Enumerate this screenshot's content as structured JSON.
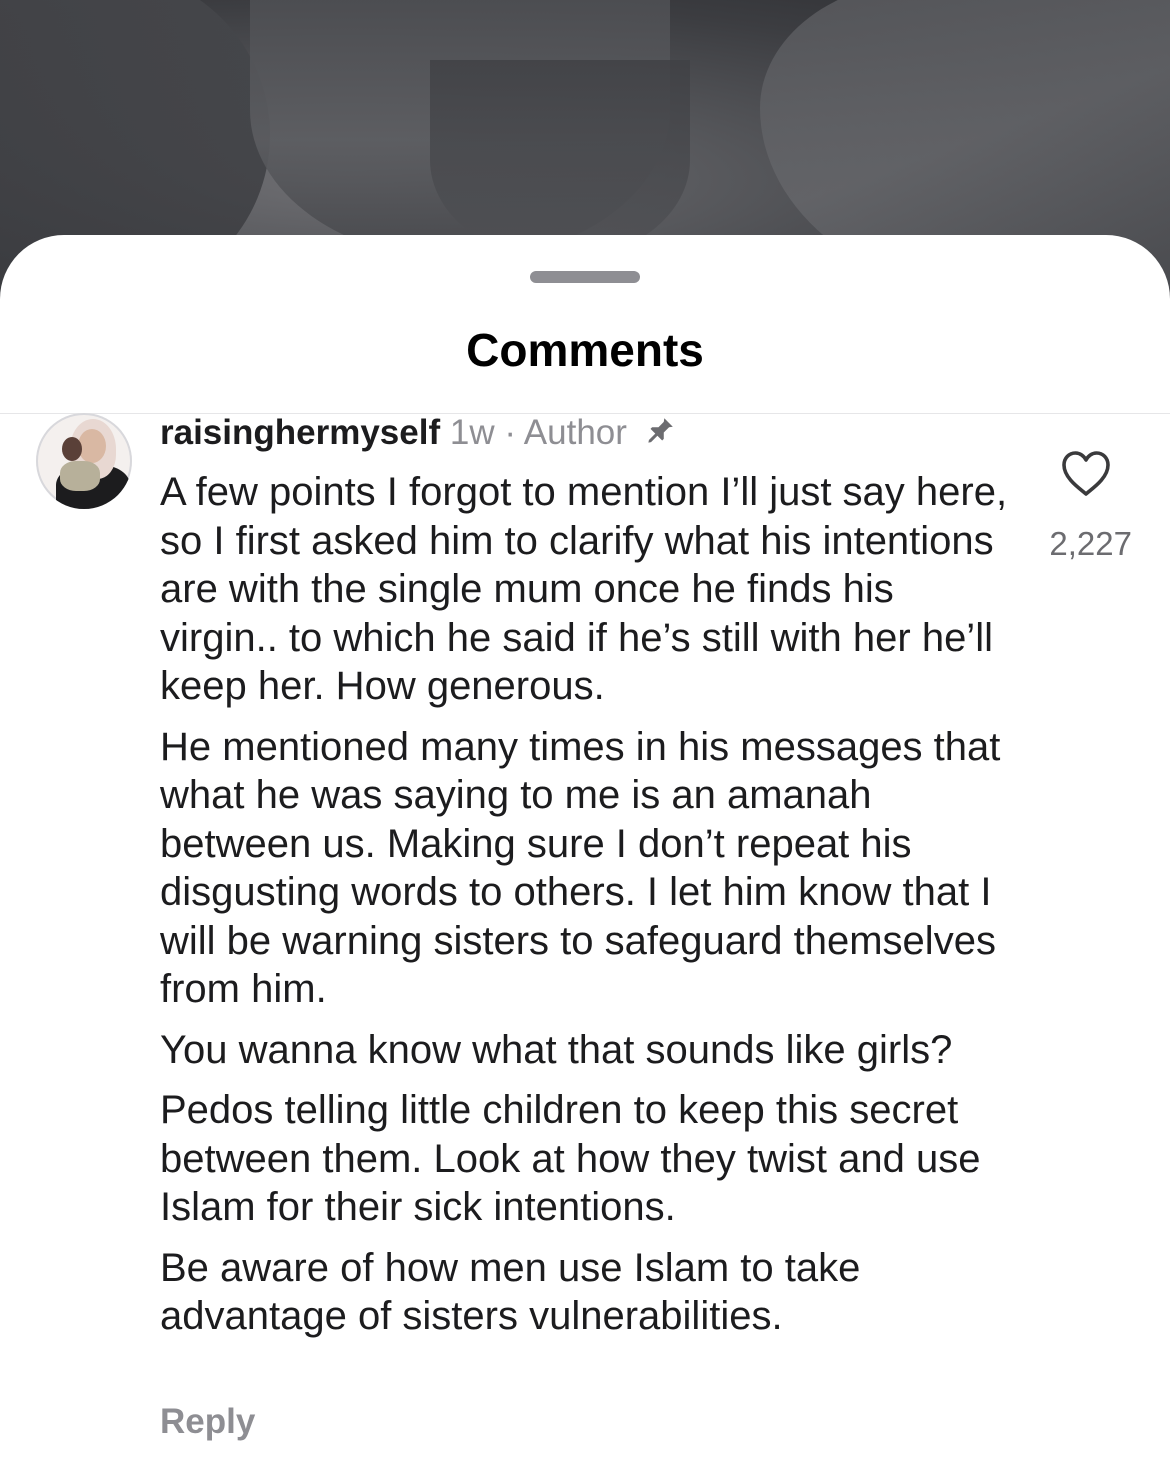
{
  "sheet": {
    "title": "Comments"
  },
  "comment": {
    "username": "raisinghermyself",
    "timestamp": "1w",
    "separator": "·",
    "badge": "Author",
    "pinned": true,
    "like_count": "2,227",
    "reply_label": "Reply",
    "paragraphs": [
      "A few points I forgot to mention I’ll just say here, so I first asked him to clarify what his intentions are with the single mum once he finds his virgin.. to which he said if he’s still with her he’ll keep her. How generous.",
      "He mentioned many times in his messages that what he was saying to me is an amanah between us. Making sure I don’t repeat his disgusting words to others. I let him know that I will be warning sisters to safeguard themselves from him.",
      "You wanna know what that sounds like girls?",
      "Pedos telling little children to keep this secret between them. Look at how they twist and use Islam for their sick intentions.",
      "Be aware of how men use Islam to take advantage of sisters vulnerabilities."
    ]
  },
  "icons": {
    "pin": "pin-icon",
    "like": "heart-outline-icon"
  }
}
